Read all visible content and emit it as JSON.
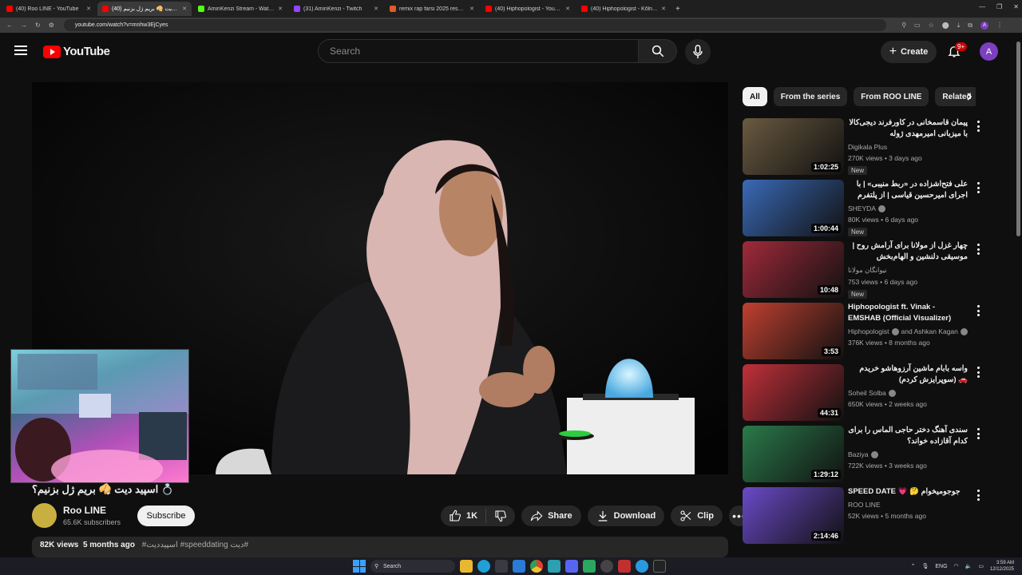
{
  "browser": {
    "tabs": [
      {
        "title": "(40) Roo LINE - YouTube",
        "color": "#ff0000",
        "active": false
      },
      {
        "title": "(40) اسپید دیت 🥠 بریم ژل بزنیم",
        "color": "#ff0000",
        "active": true
      },
      {
        "title": "AminKenzi Stream - Watch Live",
        "color": "#53fc18",
        "active": false
      },
      {
        "title": "(31) AminKenzi - Twitch",
        "color": "#9146ff",
        "active": false
      },
      {
        "title": "remix rap farsi 2025 results on",
        "color": "#e05a2a",
        "active": false
      },
      {
        "title": "(40) Hiphopologist - YouTube",
        "color": "#ff0000",
        "active": false
      },
      {
        "title": "(40) Hiphopologist - Kōln (Offi",
        "color": "#ff0000",
        "active": false
      }
    ],
    "new_tab": "+",
    "url": "youtube.com/watch?v=mnhw3EjCyes",
    "profile_initial": "A"
  },
  "header": {
    "logo_text": "YouTube",
    "search_placeholder": "Search",
    "create_label": "Create",
    "notif_badge": "9+",
    "avatar_initial": "A"
  },
  "video": {
    "title": "💍 اسپید دیت 🥠 بریم ژل بزنیم؟",
    "channel_name": "Roo LINE",
    "subscribers": "65.6K subscribers",
    "subscribe_label": "Subscribe",
    "likes": "1K",
    "share_label": "Share",
    "download_label": "Download",
    "clip_label": "Clip",
    "views": "82K views",
    "age": "5 months ago",
    "tags": "#اسپیددیت #speeddating دیت#"
  },
  "chips": [
    {
      "label": "All",
      "active": true
    },
    {
      "label": "From the series",
      "active": false
    },
    {
      "label": "From ROO LINE",
      "active": false
    },
    {
      "label": "Related",
      "active": false
    }
  ],
  "recommendations": [
    {
      "title": "پیمان قاسمخانی در کاورفرند دیجی‌کالا با میزبانی امیرمهدی ژوله",
      "channel": "Digikala Plus",
      "verified": false,
      "meta": "270K views • 3 days ago",
      "duration": "1:02:25",
      "is_new": true,
      "new_label": "New",
      "thumb_color": "#6a5a40"
    },
    {
      "title": "علی فتح‌اشزاده در «ربط منیبی» | با اجرای امیرحسین قیاسی | از پلتفرم شید",
      "channel": "SHEYDA",
      "verified": true,
      "meta": "80K views • 6 days ago",
      "duration": "1:00:44",
      "is_new": true,
      "new_label": "New",
      "thumb_color": "#3a6ab8"
    },
    {
      "title": "چهار غزل از مولانا برای آرامش روح | موسیقی دلنشین و الهام‌بخش",
      "channel": "نیوانگان مولانا",
      "verified": false,
      "meta": "753 views • 6 days ago",
      "duration": "10:48",
      "is_new": true,
      "new_label": "New",
      "thumb_color": "#a02a3a"
    },
    {
      "title": "Hiphopologist ft. Vinak - EMSHAB (Official Visualizer)",
      "channel": "Hiphopologist",
      "channel2": "and Ashkan Kagan",
      "verified": true,
      "meta": "376K views • 8 months ago",
      "duration": "3:53",
      "is_new": false,
      "thumb_color": "#c04030"
    },
    {
      "title": "واسه بابام ماشین آرزوهاشو خریدم 🚗 (سوپرایزش کردم)",
      "channel": "Soheil Solba",
      "verified": true,
      "meta": "650K views • 2 weeks ago",
      "duration": "44:31",
      "is_new": false,
      "thumb_color": "#c0303a"
    },
    {
      "title": "سندی آهنگ دختر حاجی الماس را برای کدام آقازاده خواند؟",
      "channel": "Baziya",
      "verified": true,
      "meta": "722K views • 3 weeks ago",
      "duration": "1:29:12",
      "is_new": false,
      "thumb_color": "#2a7a4a"
    },
    {
      "title": "SPEED DATE 💗 🤔 جوجومیخوام",
      "channel": "ROO LINE",
      "verified": false,
      "meta": "52K views • 5 months ago",
      "duration": "2:14:46",
      "is_new": false,
      "thumb_color": "#6a4ac8"
    }
  ],
  "taskbar": {
    "search_label": "Search",
    "lang": "ENG",
    "time": "3:59 AM",
    "date": "12/12/2025"
  }
}
